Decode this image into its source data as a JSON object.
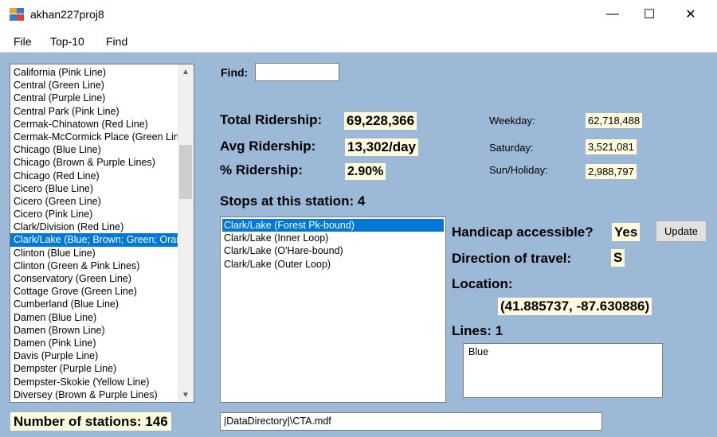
{
  "window": {
    "title": "akhan227proj8",
    "min_glyph": "—",
    "max_glyph": "☐",
    "close_glyph": "✕"
  },
  "menu": [
    "File",
    "Top-10",
    "Find"
  ],
  "stations": {
    "items": [
      "California (Pink Line)",
      "Central (Green Line)",
      "Central (Purple Line)",
      "Central Park (Pink Line)",
      "Cermak-Chinatown (Red Line)",
      "Cermak-McCormick Place (Green Line)",
      "Chicago (Blue Line)",
      "Chicago (Brown & Purple Lines)",
      "Chicago (Red Line)",
      "Cicero (Blue Line)",
      "Cicero (Green Line)",
      "Cicero (Pink Line)",
      "Clark/Division (Red Line)",
      "Clark/Lake (Blue; Brown; Green; Orange; Pink & Purple Lines)",
      "Clinton (Blue Line)",
      "Clinton (Green & Pink Lines)",
      "Conservatory (Green Line)",
      "Cottage Grove (Green Line)",
      "Cumberland (Blue Line)",
      "Damen (Blue Line)",
      "Damen (Brown Line)",
      "Damen (Pink Line)",
      "Davis (Purple Line)",
      "Dempster (Purple Line)",
      "Dempster-Skokie  (Yellow Line)",
      "Diversey (Brown & Purple Lines)"
    ],
    "selected_index": 13,
    "scroll_up_icon": "▲",
    "scroll_down_icon": "▼"
  },
  "count": {
    "label": "Number of stations:",
    "value": "146"
  },
  "find": {
    "label": "Find:",
    "value": ""
  },
  "ridership": {
    "total_label": "Total Ridership:",
    "total_value": "69,228,366",
    "avg_label": "Avg Ridership:",
    "avg_value": "13,302/day",
    "pct_label": "% Ridership:",
    "pct_value": "2.90%",
    "weekday_label": "Weekday:",
    "weekday_value": "62,718,488",
    "saturday_label": "Saturday:",
    "saturday_value": "3,521,081",
    "sunday_label": "Sun/Holiday:",
    "sunday_value": "2,988,797"
  },
  "stops": {
    "label": "Stops at this station:",
    "count": "4",
    "items": [
      "Clark/Lake (Forest Pk-bound)",
      "Clark/Lake (Inner Loop)",
      "Clark/Lake (O'Hare-bound)",
      "Clark/Lake (Outer Loop)"
    ],
    "selected_index": 0
  },
  "stop_details": {
    "handicap_label": "Handicap accessible?",
    "handicap_value": "Yes",
    "update_label": "Update",
    "direction_label": "Direction of travel:",
    "direction_value": "S",
    "location_label": "Location:",
    "location_value": "(41.885737, -87.630886)",
    "lines_label": "Lines:",
    "lines_count": "1",
    "lines": [
      "Blue"
    ]
  },
  "connection": {
    "value": "|DataDirectory|\\CTA.mdf"
  },
  "colors": {
    "client_bg": "#9db9d8",
    "highlight_bg": "#fffbdc",
    "selection": "#0078d7"
  }
}
